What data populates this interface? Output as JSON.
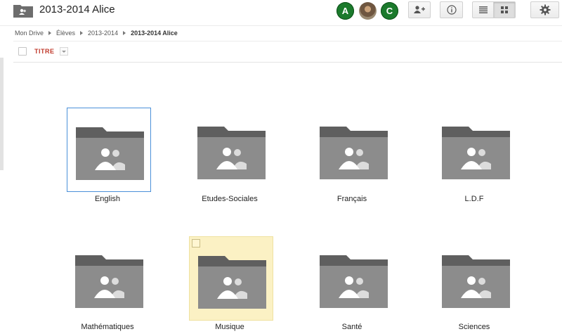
{
  "header": {
    "title": "2013-2014 Alice",
    "avatars": [
      {
        "name": "avatar-a",
        "initial": "A",
        "color": "#1b7a2c"
      },
      {
        "name": "avatar-photo",
        "initial": ""
      },
      {
        "name": "avatar-c",
        "initial": "C",
        "color": "#1b7a2c"
      }
    ],
    "buttons": [
      "share-icon",
      "info-icon",
      "list-view-icon",
      "grid-view-icon",
      "gear-icon"
    ]
  },
  "breadcrumb": {
    "items": [
      "Mon Drive",
      "Élèves",
      "2013-2014"
    ],
    "current": "2013-2014 Alice"
  },
  "list_header": {
    "column_title": "TITRE"
  },
  "folders": [
    {
      "label": "English"
    },
    {
      "label": "Etudes-Sociales"
    },
    {
      "label": "Français"
    },
    {
      "label": "L.D.F"
    },
    {
      "label": "Mathématiques"
    },
    {
      "label": "Musique"
    },
    {
      "label": "Santé"
    },
    {
      "label": "Sciences"
    }
  ],
  "colors": {
    "accent_red": "#c0392b",
    "selection_blue": "#4a90d9",
    "hover_yellow": "#fbf1c4",
    "folder_gray": "#8c8c8c",
    "folder_tab": "#5f5f5f"
  }
}
